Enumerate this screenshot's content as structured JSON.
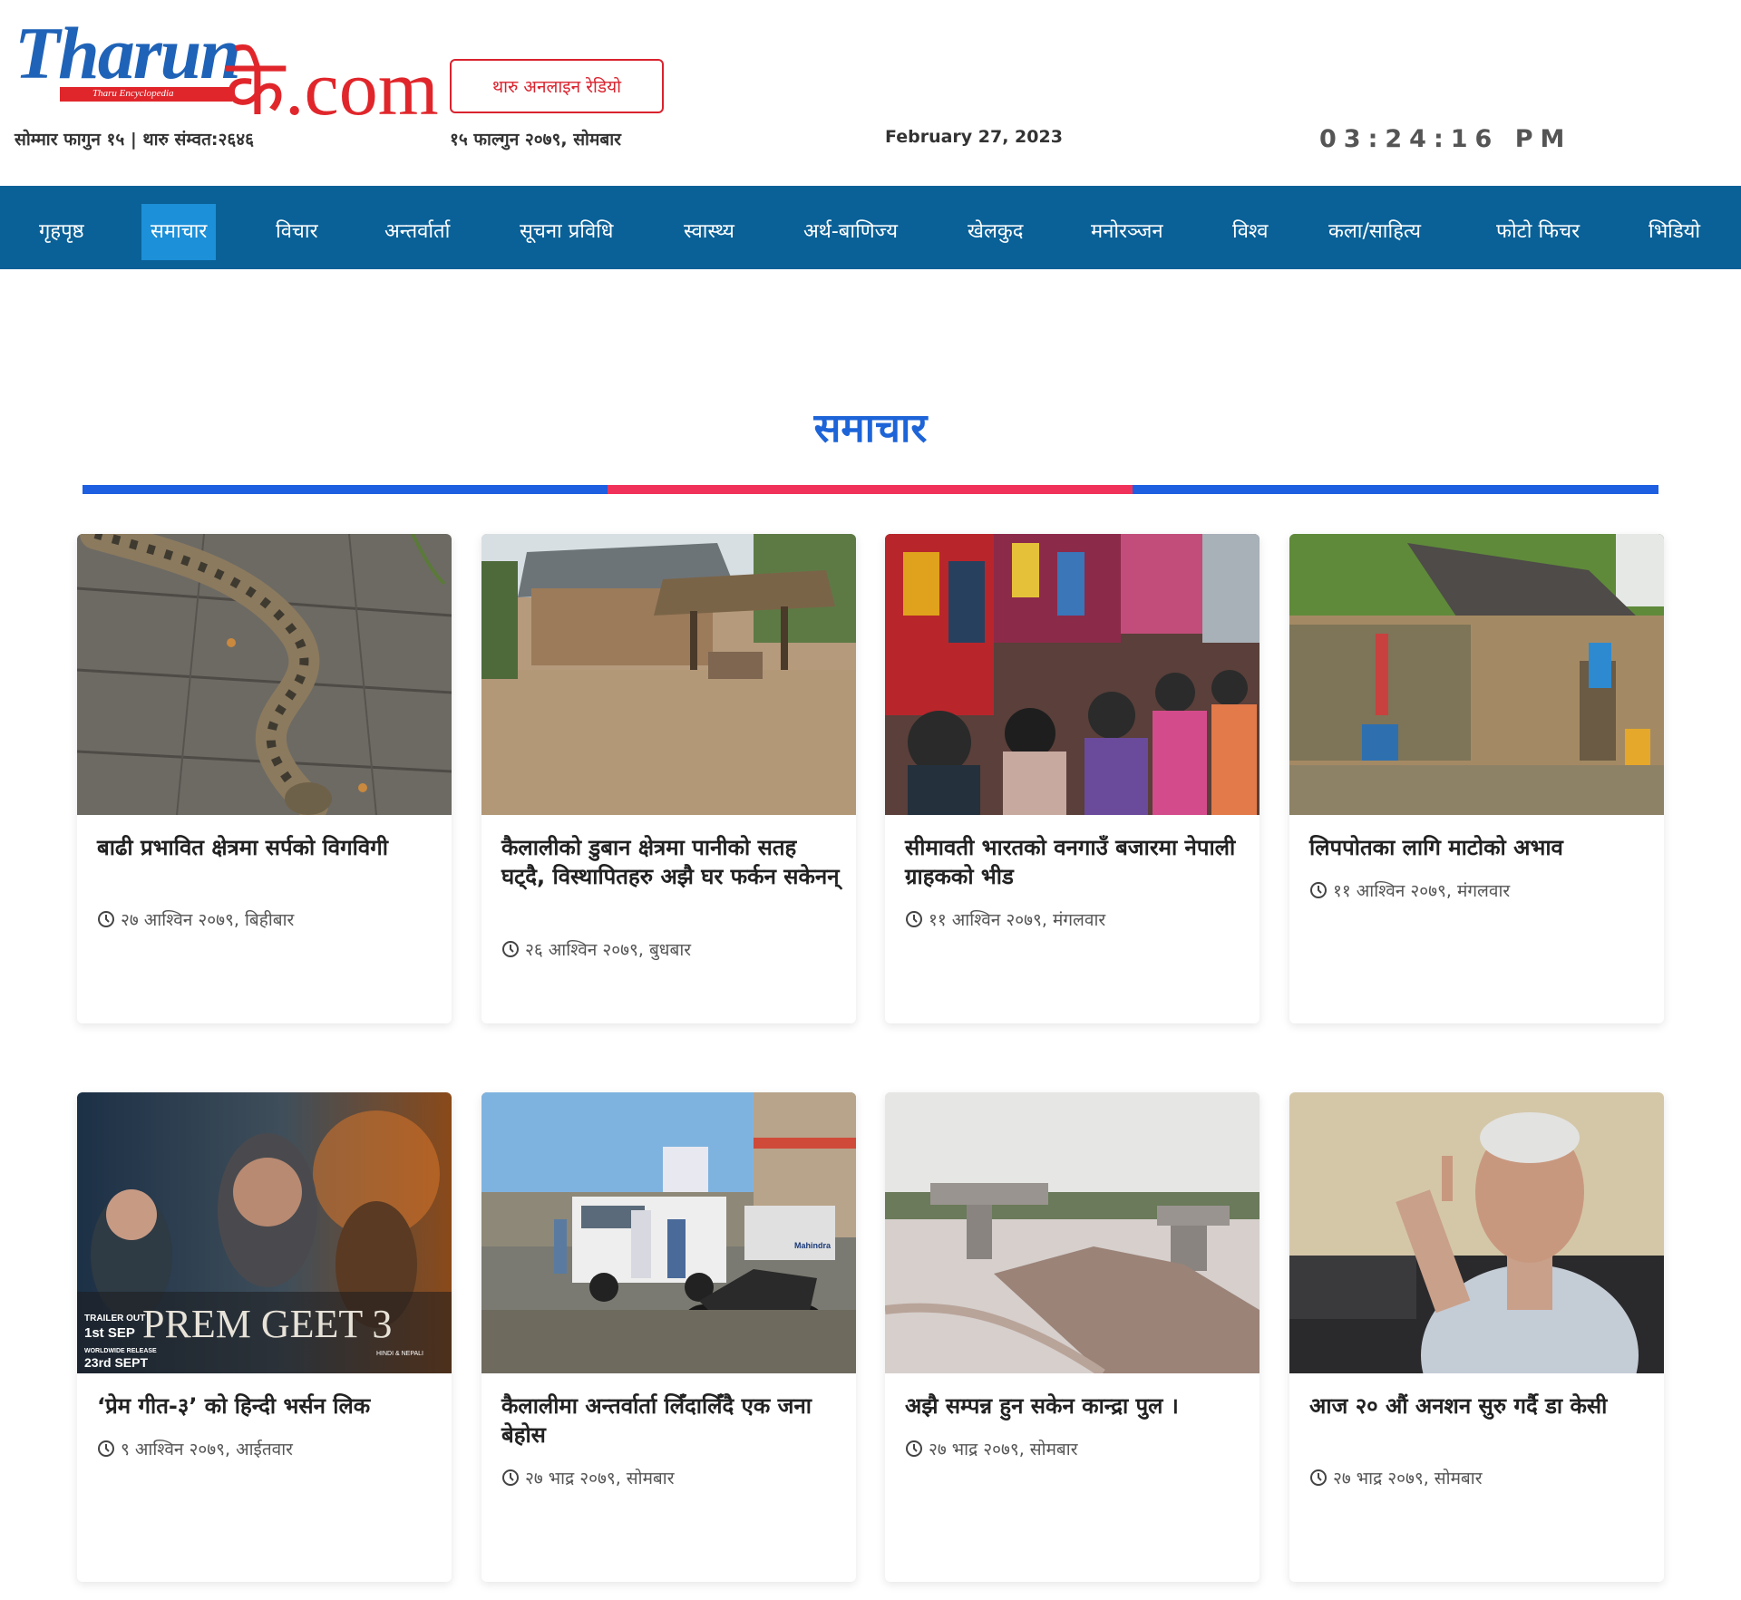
{
  "logo": {
    "main": "Tharun",
    "suffix": "के.com",
    "tagline": "Tharu Encyclopedia"
  },
  "header": {
    "radio_button": "थारु अनलाइन रेडियो",
    "tharu_date": "सोम्मार फागुन १५ | थारु संम्वत:२६४६",
    "nepali_date": "१५ फाल्गुन २०७९, सोमबार",
    "english_date": "February 27, 2023",
    "clock": "03:24:16 PM"
  },
  "nav": {
    "items": [
      {
        "label": "गृहपृष्ठ"
      },
      {
        "label": "समाचार"
      },
      {
        "label": "विचार"
      },
      {
        "label": "अन्तर्वार्ता"
      },
      {
        "label": "सूचना प्रविधि"
      },
      {
        "label": "स्वास्थ्य"
      },
      {
        "label": "अर्थ-बाणिज्य"
      },
      {
        "label": "खेलकुद"
      },
      {
        "label": "मनोरञ्जन"
      },
      {
        "label": "विश्व"
      },
      {
        "label": "कला/साहित्य"
      },
      {
        "label": "फोटो फिचर"
      },
      {
        "label": "भिडियो"
      }
    ],
    "active": "समाचार"
  },
  "section": {
    "title": "समाचार"
  },
  "colors": {
    "nav_bg": "#0a6198",
    "nav_active": "#1c90d8",
    "title_blue": "#1d64d8",
    "line_blue": "#1d5fe0",
    "line_red": "#f0325a",
    "brand_red": "#d9232e"
  },
  "articles": [
    {
      "title": "बाढी प्रभावित क्षेत्रमा सर्पको विगविगी",
      "date": "२७ आश्विन २०७९, बिहीबार",
      "image": "python snake on wooden floor"
    },
    {
      "title": "कैलालीको डुबान क्षेत्रमा पानीको सतह घट्दै, विस्थापितहरु अझै घर फर्कन सकेनन्",
      "date": "२६ आश्विन २०७९, बुधबार",
      "image": "flooded village huts"
    },
    {
      "title": "सीमावती भारतको वनगाउँ बजारमा नेपाली ग्राहकको भीड",
      "date": "११ आश्विन २०७९, मंगलवार",
      "image": "crowded clothing market"
    },
    {
      "title": "लिपपोतका लागि माटोको अभाव",
      "date": "११ आश्विन २०७९, मंगलवार",
      "image": "woman plastering mud house"
    },
    {
      "title": "‘प्रेम गीत-३’ को हिन्दी भर्सन लिक",
      "date": "९ आश्विन २०७९, आईतवार",
      "image": "Prem Geet 3 movie poster"
    },
    {
      "title": "कैलालीमा अन्तर्वार्ता लिँदालिँदै एक जना बेहोस",
      "date": "२७ भाद्र २०७९, सोमबार",
      "image": "ambulance and motorcycle on road"
    },
    {
      "title": "अझै सम्पन्न हुन सकेन कान्द्रा पुल ।",
      "date": "२७ भाद्र २०७९, सोमबार",
      "image": "unfinished bridge over river"
    },
    {
      "title": "आज २० औं अनशन सुरु गर्दै डा केसी",
      "date": "२७ भाद्र २०७९, सोमबार",
      "image": "man pointing finger"
    }
  ],
  "poster": {
    "title": "PREM GEET 3",
    "trailer": "TRAILER OUT",
    "trailer_date": "1st SEP",
    "release": "WORLDWIDE RELEASE",
    "release_date": "23rd SEPT",
    "lang": "HINDI & NEPALI"
  },
  "photo_text": {
    "mahindra": "Mahindra"
  }
}
